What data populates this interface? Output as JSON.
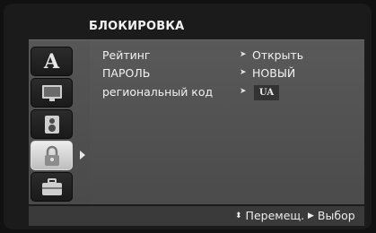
{
  "menu": {
    "title": "БЛОКИРОВКА",
    "icons": [
      {
        "name": "language-icon",
        "glyph": "A"
      },
      {
        "name": "display-icon",
        "glyph": ""
      },
      {
        "name": "audio-speaker-icon",
        "glyph": ""
      },
      {
        "name": "lock-icon",
        "glyph": ""
      },
      {
        "name": "briefcase-icon",
        "glyph": ""
      }
    ],
    "active_icon": "lock-icon"
  },
  "settings": [
    {
      "label": "Рейтинг",
      "value": "Открыть"
    },
    {
      "label": "ПАРОЛЬ",
      "value": "НОВЫЙ"
    },
    {
      "label": "региональный код",
      "value": "UA"
    }
  ],
  "footer": {
    "move_glyph": "⬍",
    "move_label": "Перемещ.",
    "select_glyph": "▶",
    "select_label": "Выбор"
  },
  "colors": {
    "background": "#1b1b1b",
    "panel": "#525252",
    "active_tab": "#e0e0e0",
    "text": "#f2f2f2"
  }
}
